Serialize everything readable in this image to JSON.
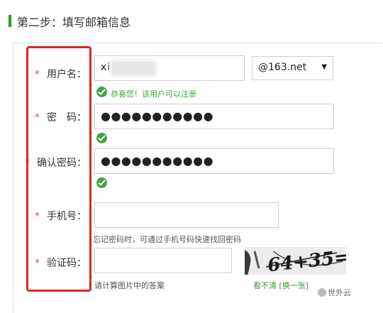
{
  "header": {
    "title": "第二步：填写邮箱信息"
  },
  "form": {
    "username": {
      "required_mark": "*",
      "label": "用户名：",
      "value": "xi",
      "domain": "@163.net",
      "success": "恭喜您！该用户可以注册"
    },
    "password": {
      "required_mark": "*",
      "label": "密　码：",
      "value": "●●●●●●●●●●●"
    },
    "confirm_password": {
      "required_mark": "*",
      "label": "确认密码：",
      "value": "●●●●●●●●●●●"
    },
    "phone": {
      "required_mark": "*",
      "label": "手机号：",
      "value": "",
      "hint": "忘记密码时，可通过手机号码快速找回密码"
    },
    "captcha": {
      "required_mark": "*",
      "label": "验证码：",
      "value": "",
      "hint": "请计算图片中的答案",
      "image_text": "64+35=?",
      "refresh_link": "看不清 [换一张]"
    }
  },
  "watermark": {
    "text": "世外云"
  },
  "colors": {
    "accent": "#2e9b2e",
    "highlight": "#d9262b",
    "success": "#42a542"
  },
  "icons": {
    "success": "check-circle-icon",
    "dropdown": "chevron-down-icon"
  }
}
